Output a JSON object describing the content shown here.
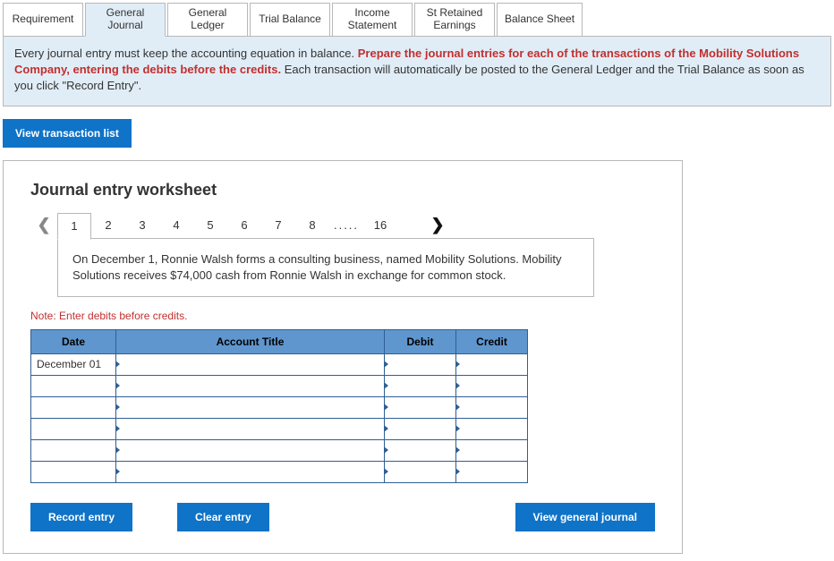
{
  "tabs": {
    "requirement": "Requirement",
    "general_journal": "General\nJournal",
    "general_ledger": "General\nLedger",
    "trial_balance": "Trial Balance",
    "income_statement": "Income\nStatement",
    "retained_earnings": "St Retained\nEarnings",
    "balance_sheet": "Balance Sheet"
  },
  "banner": {
    "lead": "Every journal entry must keep the accounting equation in balance. ",
    "bold": "Prepare the journal entries for each of the transactions of the Mobility Solutions Company, entering the debits before the credits.",
    "trail": " Each transaction will automatically be posted to the General Ledger and the Trial Balance as soon as you click \"Record Entry\"."
  },
  "buttons": {
    "view_transactions": "View transaction list",
    "record_entry": "Record entry",
    "clear_entry": "Clear entry",
    "view_general_journal": "View general journal"
  },
  "worksheet": {
    "title": "Journal entry worksheet",
    "pager": [
      "1",
      "2",
      "3",
      "4",
      "5",
      "6",
      "7",
      "8",
      ".....",
      "16"
    ],
    "active_page": "1",
    "transaction_text": "On December 1, Ronnie Walsh forms a consulting business, named Mobility Solutions. Mobility Solutions receives $74,000 cash from Ronnie Walsh in exchange for common stock.",
    "note": "Note: Enter debits before credits.",
    "columns": {
      "date": "Date",
      "title": "Account Title",
      "debit": "Debit",
      "credit": "Credit"
    },
    "rows": [
      {
        "date": "December 01",
        "title": "",
        "debit": "",
        "credit": ""
      },
      {
        "date": "",
        "title": "",
        "debit": "",
        "credit": ""
      },
      {
        "date": "",
        "title": "",
        "debit": "",
        "credit": ""
      },
      {
        "date": "",
        "title": "",
        "debit": "",
        "credit": ""
      },
      {
        "date": "",
        "title": "",
        "debit": "",
        "credit": ""
      },
      {
        "date": "",
        "title": "",
        "debit": "",
        "credit": ""
      }
    ]
  }
}
